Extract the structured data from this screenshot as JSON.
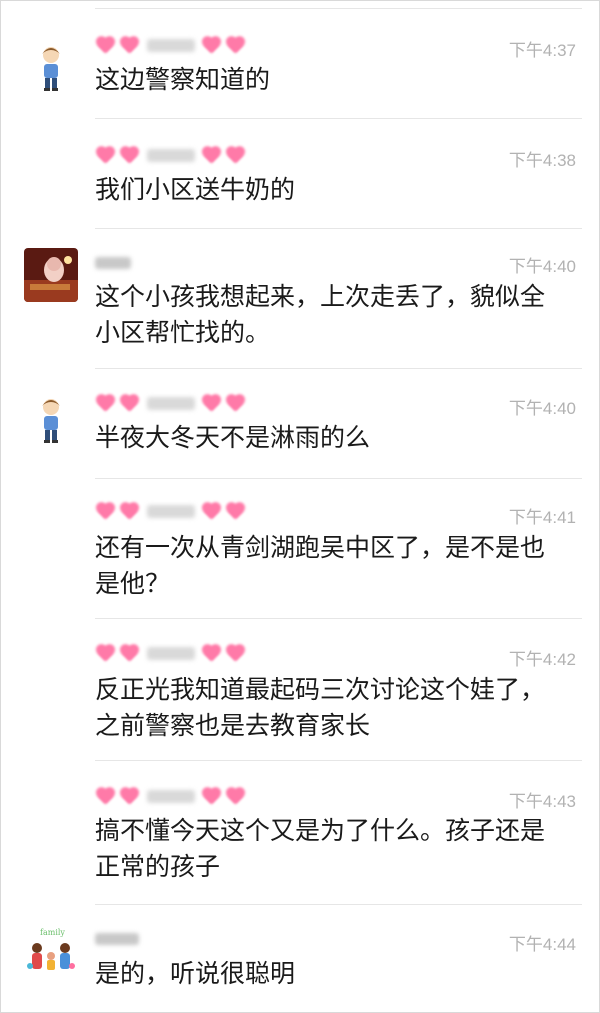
{
  "messages": [
    {
      "time": "下午4:37",
      "text": "这边警察知道的",
      "avatar": "cartoon-boy"
    },
    {
      "time": "下午4:38",
      "text": "我们小区送牛奶的",
      "avatar": "cartoon-boy"
    },
    {
      "time": "下午4:40",
      "text": "这个小孩我想起来，上次走丢了，貌似全小区帮忙找的。",
      "avatar": "photo-figurine"
    },
    {
      "time": "下午4:40",
      "text": "半夜大冬天不是淋雨的么",
      "avatar": "cartoon-boy"
    },
    {
      "time": "下午4:41",
      "text": "还有一次从青剑湖跑吴中区了，是不是也是他？",
      "avatar": "cartoon-boy"
    },
    {
      "time": "下午4:42",
      "text": "反正光我知道最起码三次讨论这个娃了，之前警察也是去教育家长",
      "avatar": "cartoon-boy"
    },
    {
      "time": "下午4:43",
      "text": "搞不懂今天这个又是为了什么。孩子还是正常的孩子",
      "avatar": "cartoon-boy"
    },
    {
      "time": "下午4:44",
      "text": "是的，听说很聪明",
      "avatar": "family-cartoon"
    }
  ],
  "colors": {
    "time": "#b2b2b2",
    "text": "#1a1a1a",
    "divider": "#e6e6e6",
    "name_blur": "#ff7aa8"
  }
}
